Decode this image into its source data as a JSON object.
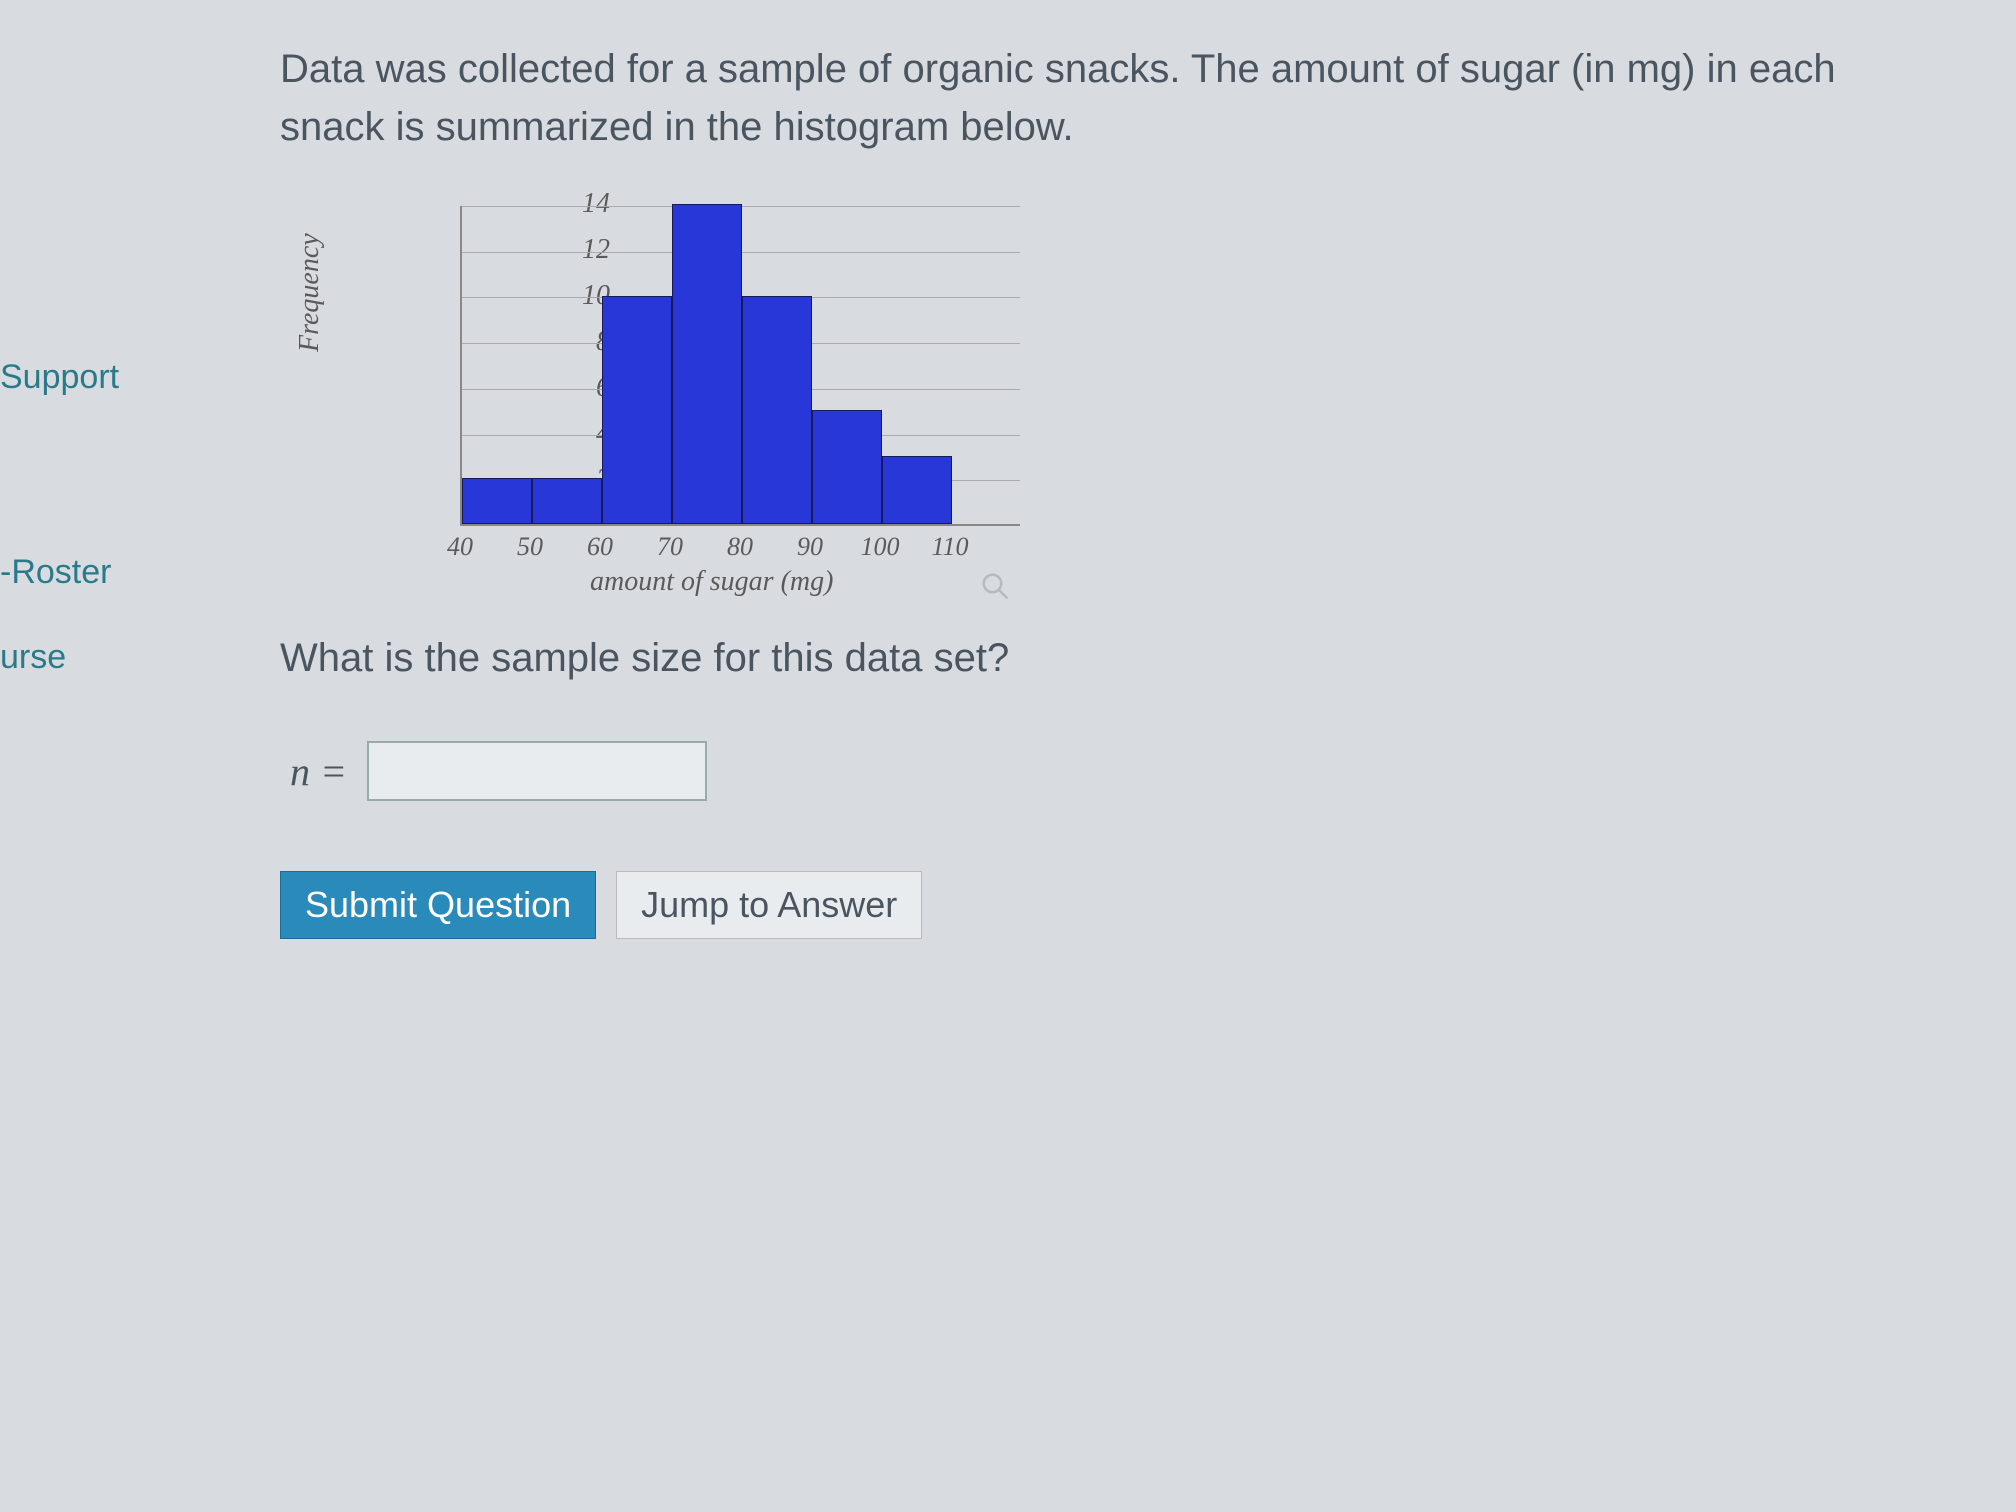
{
  "sidebar": {
    "items": [
      {
        "label": "Support"
      },
      {
        "label": "-Roster"
      },
      {
        "label": "urse"
      }
    ]
  },
  "prompt": "Data was collected for a sample of organic snacks. The amount of sugar (in mg) in each snack is summarized in the histogram below.",
  "question": "What is the sample size for this data set?",
  "answer_prefix": "n =",
  "answer_value": "",
  "buttons": {
    "submit": "Submit Question",
    "jump": "Jump to Answer"
  },
  "chart_data": {
    "type": "bar",
    "title": "",
    "xlabel": "amount of sugar (mg)",
    "ylabel": "Frequency",
    "ylim": [
      0,
      14
    ],
    "y_ticks": [
      2,
      4,
      6,
      8,
      10,
      12,
      14
    ],
    "x_ticks": [
      40,
      50,
      60,
      70,
      80,
      90,
      100,
      110
    ],
    "bin_edges": [
      40,
      50,
      60,
      70,
      80,
      90,
      100,
      110
    ],
    "values": [
      2,
      2,
      10,
      14,
      10,
      5,
      3
    ]
  }
}
